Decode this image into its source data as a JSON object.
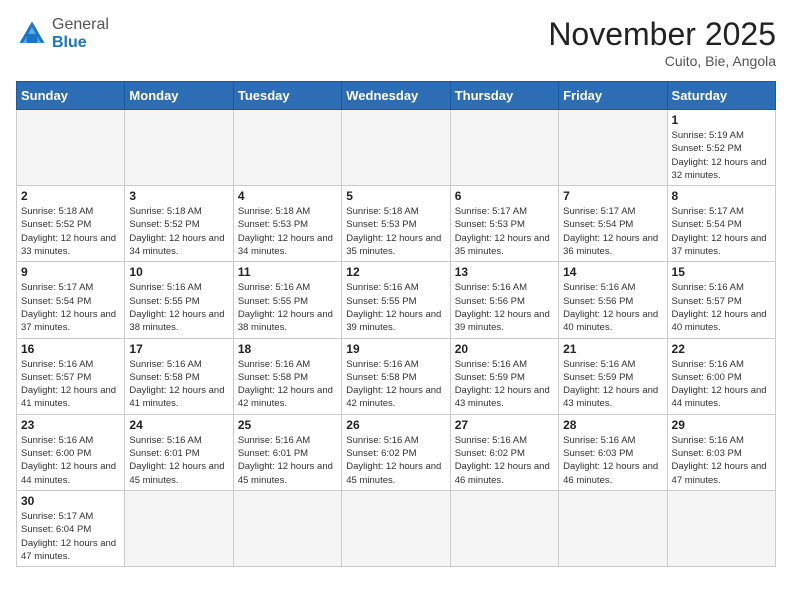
{
  "header": {
    "logo_general": "General",
    "logo_blue": "Blue",
    "month_title": "November 2025",
    "location": "Cuito, Bie, Angola"
  },
  "calendar": {
    "days_of_week": [
      "Sunday",
      "Monday",
      "Tuesday",
      "Wednesday",
      "Thursday",
      "Friday",
      "Saturday"
    ],
    "weeks": [
      [
        {
          "day": "",
          "info": ""
        },
        {
          "day": "",
          "info": ""
        },
        {
          "day": "",
          "info": ""
        },
        {
          "day": "",
          "info": ""
        },
        {
          "day": "",
          "info": ""
        },
        {
          "day": "",
          "info": ""
        },
        {
          "day": "1",
          "info": "Sunrise: 5:19 AM\nSunset: 5:52 PM\nDaylight: 12 hours and 32 minutes."
        }
      ],
      [
        {
          "day": "2",
          "info": "Sunrise: 5:18 AM\nSunset: 5:52 PM\nDaylight: 12 hours and 33 minutes."
        },
        {
          "day": "3",
          "info": "Sunrise: 5:18 AM\nSunset: 5:52 PM\nDaylight: 12 hours and 34 minutes."
        },
        {
          "day": "4",
          "info": "Sunrise: 5:18 AM\nSunset: 5:53 PM\nDaylight: 12 hours and 34 minutes."
        },
        {
          "day": "5",
          "info": "Sunrise: 5:18 AM\nSunset: 5:53 PM\nDaylight: 12 hours and 35 minutes."
        },
        {
          "day": "6",
          "info": "Sunrise: 5:17 AM\nSunset: 5:53 PM\nDaylight: 12 hours and 35 minutes."
        },
        {
          "day": "7",
          "info": "Sunrise: 5:17 AM\nSunset: 5:54 PM\nDaylight: 12 hours and 36 minutes."
        },
        {
          "day": "8",
          "info": "Sunrise: 5:17 AM\nSunset: 5:54 PM\nDaylight: 12 hours and 37 minutes."
        }
      ],
      [
        {
          "day": "9",
          "info": "Sunrise: 5:17 AM\nSunset: 5:54 PM\nDaylight: 12 hours and 37 minutes."
        },
        {
          "day": "10",
          "info": "Sunrise: 5:16 AM\nSunset: 5:55 PM\nDaylight: 12 hours and 38 minutes."
        },
        {
          "day": "11",
          "info": "Sunrise: 5:16 AM\nSunset: 5:55 PM\nDaylight: 12 hours and 38 minutes."
        },
        {
          "day": "12",
          "info": "Sunrise: 5:16 AM\nSunset: 5:55 PM\nDaylight: 12 hours and 39 minutes."
        },
        {
          "day": "13",
          "info": "Sunrise: 5:16 AM\nSunset: 5:56 PM\nDaylight: 12 hours and 39 minutes."
        },
        {
          "day": "14",
          "info": "Sunrise: 5:16 AM\nSunset: 5:56 PM\nDaylight: 12 hours and 40 minutes."
        },
        {
          "day": "15",
          "info": "Sunrise: 5:16 AM\nSunset: 5:57 PM\nDaylight: 12 hours and 40 minutes."
        }
      ],
      [
        {
          "day": "16",
          "info": "Sunrise: 5:16 AM\nSunset: 5:57 PM\nDaylight: 12 hours and 41 minutes."
        },
        {
          "day": "17",
          "info": "Sunrise: 5:16 AM\nSunset: 5:58 PM\nDaylight: 12 hours and 41 minutes."
        },
        {
          "day": "18",
          "info": "Sunrise: 5:16 AM\nSunset: 5:58 PM\nDaylight: 12 hours and 42 minutes."
        },
        {
          "day": "19",
          "info": "Sunrise: 5:16 AM\nSunset: 5:58 PM\nDaylight: 12 hours and 42 minutes."
        },
        {
          "day": "20",
          "info": "Sunrise: 5:16 AM\nSunset: 5:59 PM\nDaylight: 12 hours and 43 minutes."
        },
        {
          "day": "21",
          "info": "Sunrise: 5:16 AM\nSunset: 5:59 PM\nDaylight: 12 hours and 43 minutes."
        },
        {
          "day": "22",
          "info": "Sunrise: 5:16 AM\nSunset: 6:00 PM\nDaylight: 12 hours and 44 minutes."
        }
      ],
      [
        {
          "day": "23",
          "info": "Sunrise: 5:16 AM\nSunset: 6:00 PM\nDaylight: 12 hours and 44 minutes."
        },
        {
          "day": "24",
          "info": "Sunrise: 5:16 AM\nSunset: 6:01 PM\nDaylight: 12 hours and 45 minutes."
        },
        {
          "day": "25",
          "info": "Sunrise: 5:16 AM\nSunset: 6:01 PM\nDaylight: 12 hours and 45 minutes."
        },
        {
          "day": "26",
          "info": "Sunrise: 5:16 AM\nSunset: 6:02 PM\nDaylight: 12 hours and 45 minutes."
        },
        {
          "day": "27",
          "info": "Sunrise: 5:16 AM\nSunset: 6:02 PM\nDaylight: 12 hours and 46 minutes."
        },
        {
          "day": "28",
          "info": "Sunrise: 5:16 AM\nSunset: 6:03 PM\nDaylight: 12 hours and 46 minutes."
        },
        {
          "day": "29",
          "info": "Sunrise: 5:16 AM\nSunset: 6:03 PM\nDaylight: 12 hours and 47 minutes."
        }
      ],
      [
        {
          "day": "30",
          "info": "Sunrise: 5:17 AM\nSunset: 6:04 PM\nDaylight: 12 hours and 47 minutes."
        },
        {
          "day": "",
          "info": ""
        },
        {
          "day": "",
          "info": ""
        },
        {
          "day": "",
          "info": ""
        },
        {
          "day": "",
          "info": ""
        },
        {
          "day": "",
          "info": ""
        },
        {
          "day": "",
          "info": ""
        }
      ]
    ]
  }
}
